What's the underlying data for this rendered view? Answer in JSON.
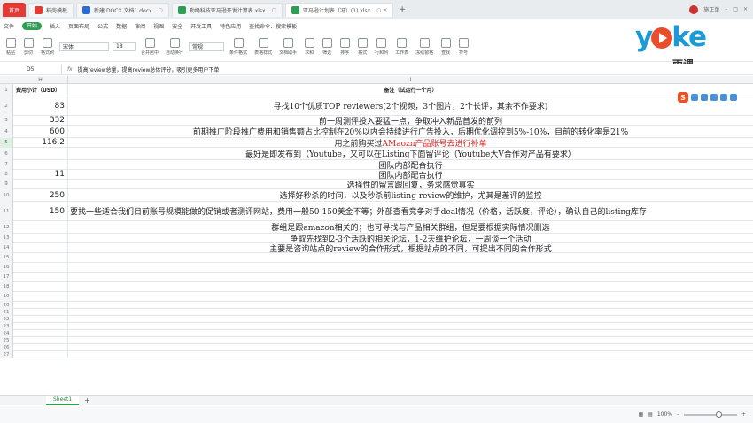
{
  "tabs": [
    {
      "label": "首页",
      "icon": "home-icon",
      "color": "#e53935"
    },
    {
      "label": "稻壳模板",
      "icon": "docer-icon",
      "color": "#e53935"
    },
    {
      "label": "新建 DOCX 文档1.docx",
      "icon": "word-icon",
      "color": "#2b6cd4"
    },
    {
      "label": "勤绳科技亚马逊开发计算表.xlsx",
      "icon": "excel-icon",
      "color": "#2e9f52"
    },
    {
      "label": "亚马逊计划表（冯）(1).xlsx",
      "icon": "excel-icon",
      "color": "#2e9f52"
    }
  ],
  "user_name": "施正单",
  "menu": [
    "文件",
    "开始",
    "插入",
    "页面布局",
    "公式",
    "数据",
    "审阅",
    "视图",
    "安全",
    "开发工具",
    "特色应用",
    "查找命令、搜索模板"
  ],
  "ribbon": {
    "font_name": "宋体",
    "font_size": "18",
    "number_format": "常规",
    "buttons": [
      "剪切",
      "复制",
      "格式刷",
      "粘贴",
      "合并居中",
      "自动换行",
      "条件格式",
      "表格样式",
      "文档助手",
      "求和",
      "筛选",
      "排序",
      "格式",
      "行和列",
      "工作表",
      "冻结窗格",
      "查找",
      "符号"
    ]
  },
  "logo": {
    "word": "yoke",
    "sub": "雨课"
  },
  "formula_bar": {
    "name_box": "D5",
    "fx": "fx",
    "content": "提高review总量，提高review总体评分，吸引更多用户下单"
  },
  "columns": {
    "h": "H",
    "i": "I"
  },
  "rows": [
    {
      "n": "1",
      "h": "费用小计（USD）",
      "i": "备注（试运行一个月）",
      "header": true
    },
    {
      "n": "2",
      "h": "83",
      "i": "寻找10个优质TOP reviewers(2个视频，3个图片，2个长评，其余不作要求)"
    },
    {
      "n": "3",
      "h": "332",
      "i": "前一周测评投入要猛一点，争取冲入新品首发的前列"
    },
    {
      "n": "4",
      "h": "600",
      "i": "前期推广阶段推广费用和销售额占比控制在20%以内会持续进行广告投入，后期优化调控到5%-10%，目前的转化率是21%"
    },
    {
      "n": "5",
      "h": "116.2",
      "i": "用之前购买过",
      "i_red": "AMaozn产品账号去进行补单"
    },
    {
      "n": "6",
      "h": "",
      "i": "最好是即发布到（Youtube，又可以在Listing下面留评论（Youtube大V合作对产品有要求）"
    },
    {
      "n": "7",
      "h": "",
      "i": "团队内部配合执行"
    },
    {
      "n": "8",
      "h": "11",
      "i": "团队内部配合执行"
    },
    {
      "n": "9",
      "h": "",
      "i": "选择性的留言跟回复，务求感觉真实"
    },
    {
      "n": "10",
      "h": "250",
      "i": "选择好秒杀的时间，以及秒杀前listing review的维护，尤其是差评的监控"
    },
    {
      "n": "11",
      "h": "150",
      "i": "要找一些适合我们目前账号规模能做的促销或者测评网站，费用一般50-150美金不等；外部查看竞争对手deal情况（价格，活跃度，评论），确认自己的listing库存"
    },
    {
      "n": "12",
      "h": "",
      "i": "群组是跟amazon相关的；也可寻找与产品相关群组，但是要根据实际情况删选"
    },
    {
      "n": "13",
      "h": "",
      "i": "争取先找到2-3个活跃的相关论坛，1-2天维护论坛，一周谈一个活动"
    },
    {
      "n": "14",
      "h": "",
      "i": "主要是咨询站点的review的合作形式，根据站点的不同，可提出不同的合作形式"
    },
    {
      "n": "15",
      "h": "",
      "i": ""
    },
    {
      "n": "16",
      "h": "",
      "i": ""
    },
    {
      "n": "17",
      "h": "",
      "i": ""
    },
    {
      "n": "18",
      "h": "",
      "i": ""
    },
    {
      "n": "19",
      "h": "",
      "i": ""
    },
    {
      "n": "20",
      "h": "",
      "i": ""
    },
    {
      "n": "21",
      "h": "",
      "i": ""
    },
    {
      "n": "22",
      "h": "",
      "i": ""
    },
    {
      "n": "23",
      "h": "",
      "i": ""
    },
    {
      "n": "24",
      "h": "",
      "i": ""
    },
    {
      "n": "25",
      "h": "",
      "i": ""
    },
    {
      "n": "26",
      "h": "",
      "i": ""
    },
    {
      "n": "27",
      "h": "",
      "i": ""
    }
  ],
  "sheet_tab": "Sheet1",
  "zoom": "100%",
  "zoom_level": 0.6
}
